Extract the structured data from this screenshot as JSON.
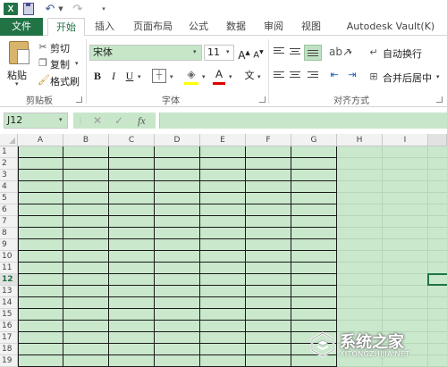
{
  "qat": {
    "logo": "X",
    "icons": [
      "excel-icon",
      "save-icon",
      "undo-icon",
      "redo-icon"
    ]
  },
  "tabs": [
    {
      "label": "文件"
    },
    {
      "label": "开始"
    },
    {
      "label": "插入"
    },
    {
      "label": "页面布局"
    },
    {
      "label": "公式"
    },
    {
      "label": "数据"
    },
    {
      "label": "审阅"
    },
    {
      "label": "视图"
    },
    {
      "label": "Autodesk Vault(K)"
    }
  ],
  "ribbon": {
    "clipboard": {
      "paste": "粘贴",
      "cut": "剪切",
      "copy": "复制",
      "format_painter": "格式刷",
      "label": "剪贴板"
    },
    "font": {
      "name": "宋体",
      "size": "11",
      "bold": "B",
      "italic": "I",
      "underline": "U",
      "font_color": "A",
      "phonetic": "文",
      "label": "字体"
    },
    "alignment": {
      "wrap_text": "自动换行",
      "merge_center": "合并后居中",
      "label": "对齐方式"
    }
  },
  "formula_bar": {
    "name_box": "J12",
    "cancel": "✕",
    "enter": "✓",
    "fx": "fx",
    "value": ""
  },
  "sheet": {
    "columns": [
      "A",
      "B",
      "C",
      "D",
      "E",
      "F",
      "G",
      "H",
      "I"
    ],
    "rows": [
      "1",
      "2",
      "3",
      "4",
      "5",
      "6",
      "7",
      "8",
      "9",
      "10",
      "11",
      "12",
      "13",
      "14",
      "15",
      "16",
      "17",
      "18",
      "19"
    ],
    "selected_row": "12",
    "selected_cell": "J12"
  },
  "colors": {
    "excel_green": "#217346",
    "sheet_fill": "#c9e8cc",
    "border_dark": "#1a1a1a"
  },
  "watermark": {
    "title": "系统之家",
    "url": "XITONGZHIJIA.NET"
  }
}
